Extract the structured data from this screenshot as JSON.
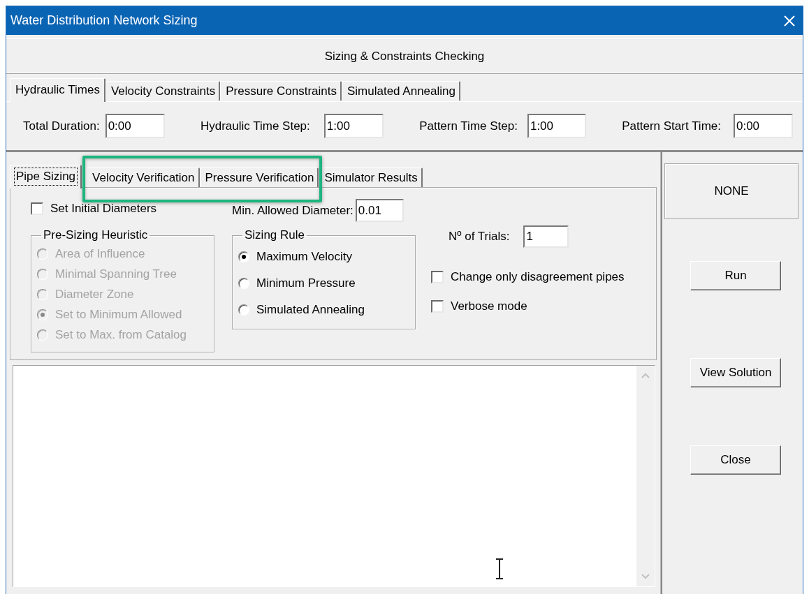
{
  "window": {
    "title": "Water Distribution Network Sizing"
  },
  "header": "Sizing & Constraints Checking",
  "top_tabs": [
    {
      "label": "Hydraulic Times",
      "selected": true
    },
    {
      "label": "Velocity Constraints",
      "selected": false
    },
    {
      "label": "Pressure Constraints",
      "selected": false
    },
    {
      "label": "Simulated Annealing",
      "selected": false
    }
  ],
  "time_fields": [
    {
      "label": "Total Duration:",
      "value": "0:00"
    },
    {
      "label": "Hydraulic Time Step:",
      "value": "1:00"
    },
    {
      "label": "Pattern Time Step:",
      "value": "1:00"
    },
    {
      "label": "Pattern Start Time:",
      "value": "0:00"
    }
  ],
  "bottom_tabs": [
    {
      "label": "Pipe Sizing",
      "selected": true,
      "focused": true,
      "highlighted": false
    },
    {
      "label": "Velocity Verification",
      "selected": false,
      "focused": false,
      "highlighted": true
    },
    {
      "label": "Pressure Verification",
      "selected": false,
      "focused": false,
      "highlighted": true
    },
    {
      "label": "Simulator Results",
      "selected": false,
      "focused": false,
      "highlighted": false
    }
  ],
  "pipe_sizing": {
    "set_initial_diameters": {
      "label": "Set Initial Diameters",
      "checked": false
    },
    "min_allowed_diameter": {
      "label": "Min. Allowed Diameter:",
      "value": "0.01"
    },
    "pre_sizing_heuristic": {
      "title": "Pre-Sizing Heuristic",
      "disabled": true,
      "options": [
        {
          "label": "Area of Influence",
          "selected": false
        },
        {
          "label": "Minimal Spanning Tree",
          "selected": false
        },
        {
          "label": "Diameter Zone",
          "selected": false
        },
        {
          "label": "Set to Minimum Allowed",
          "selected": true
        },
        {
          "label": "Set to Max. from Catalog",
          "selected": false
        }
      ]
    },
    "sizing_rule": {
      "title": "Sizing Rule",
      "options": [
        {
          "label": "Maximum Velocity",
          "selected": true
        },
        {
          "label": "Minimum Pressure",
          "selected": false
        },
        {
          "label": "Simulated Annealing",
          "selected": false
        }
      ]
    },
    "trials": {
      "label": "Nº of Trials:",
      "value": "1"
    },
    "checkboxes": [
      {
        "label": "Change only disagreement pipes",
        "checked": false
      },
      {
        "label": "Verbose mode",
        "checked": false
      }
    ]
  },
  "status": "NONE",
  "buttons": [
    "Run",
    "View Solution",
    "Close"
  ]
}
